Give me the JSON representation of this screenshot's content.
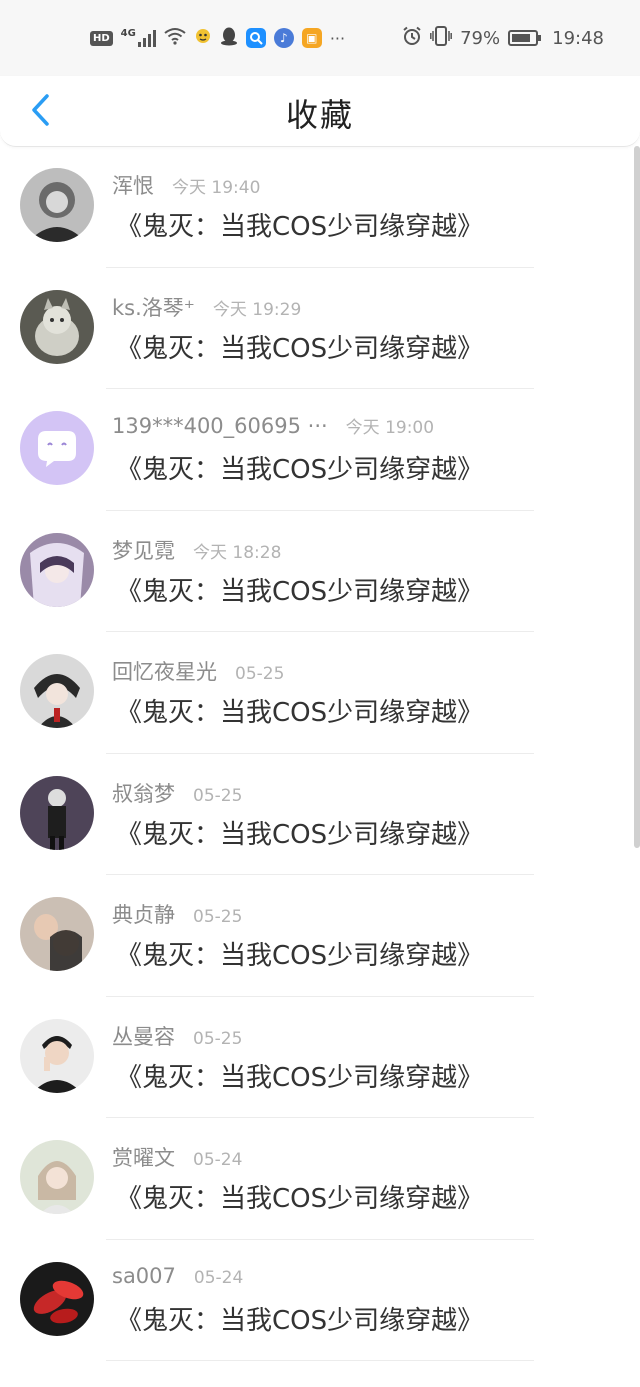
{
  "status_bar": {
    "hd": "HD",
    "network": "4G",
    "more": "···",
    "battery_percent": "79%",
    "time": "19:48"
  },
  "header": {
    "title": "收藏"
  },
  "items": [
    {
      "name": "浑恨",
      "time": "今天 19:40",
      "title": "《鬼灭：当我COS少司缘穿越》"
    },
    {
      "name": "ks.洛琴⁺",
      "time": "今天 19:29",
      "title": "《鬼灭：当我COS少司缘穿越》"
    },
    {
      "name": "139***400_60695 ···",
      "time": "今天 19:00",
      "title": "《鬼灭：当我COS少司缘穿越》"
    },
    {
      "name": "梦见霓",
      "time": "今天 18:28",
      "title": "《鬼灭：当我COS少司缘穿越》"
    },
    {
      "name": "回忆夜星光",
      "time": "05-25",
      "title": "《鬼灭：当我COS少司缘穿越》"
    },
    {
      "name": "叔翁梦",
      "time": "05-25",
      "title": "《鬼灭：当我COS少司缘穿越》"
    },
    {
      "name": "典贞静",
      "time": "05-25",
      "title": "《鬼灭：当我COS少司缘穿越》"
    },
    {
      "name": "丛曼容",
      "time": "05-25",
      "title": "《鬼灭：当我COS少司缘穿越》"
    },
    {
      "name": "赏曜文",
      "time": "05-24",
      "title": "《鬼灭：当我COS少司缘穿越》"
    },
    {
      "name": "sa007",
      "time": "05-24",
      "title": "《鬼灭：当我COS少司缘穿越》"
    }
  ],
  "colors": {
    "accent": "#2a9df4",
    "name_text": "#8c8c8c",
    "time_text": "#b3b3b3",
    "title_text": "#333333"
  }
}
